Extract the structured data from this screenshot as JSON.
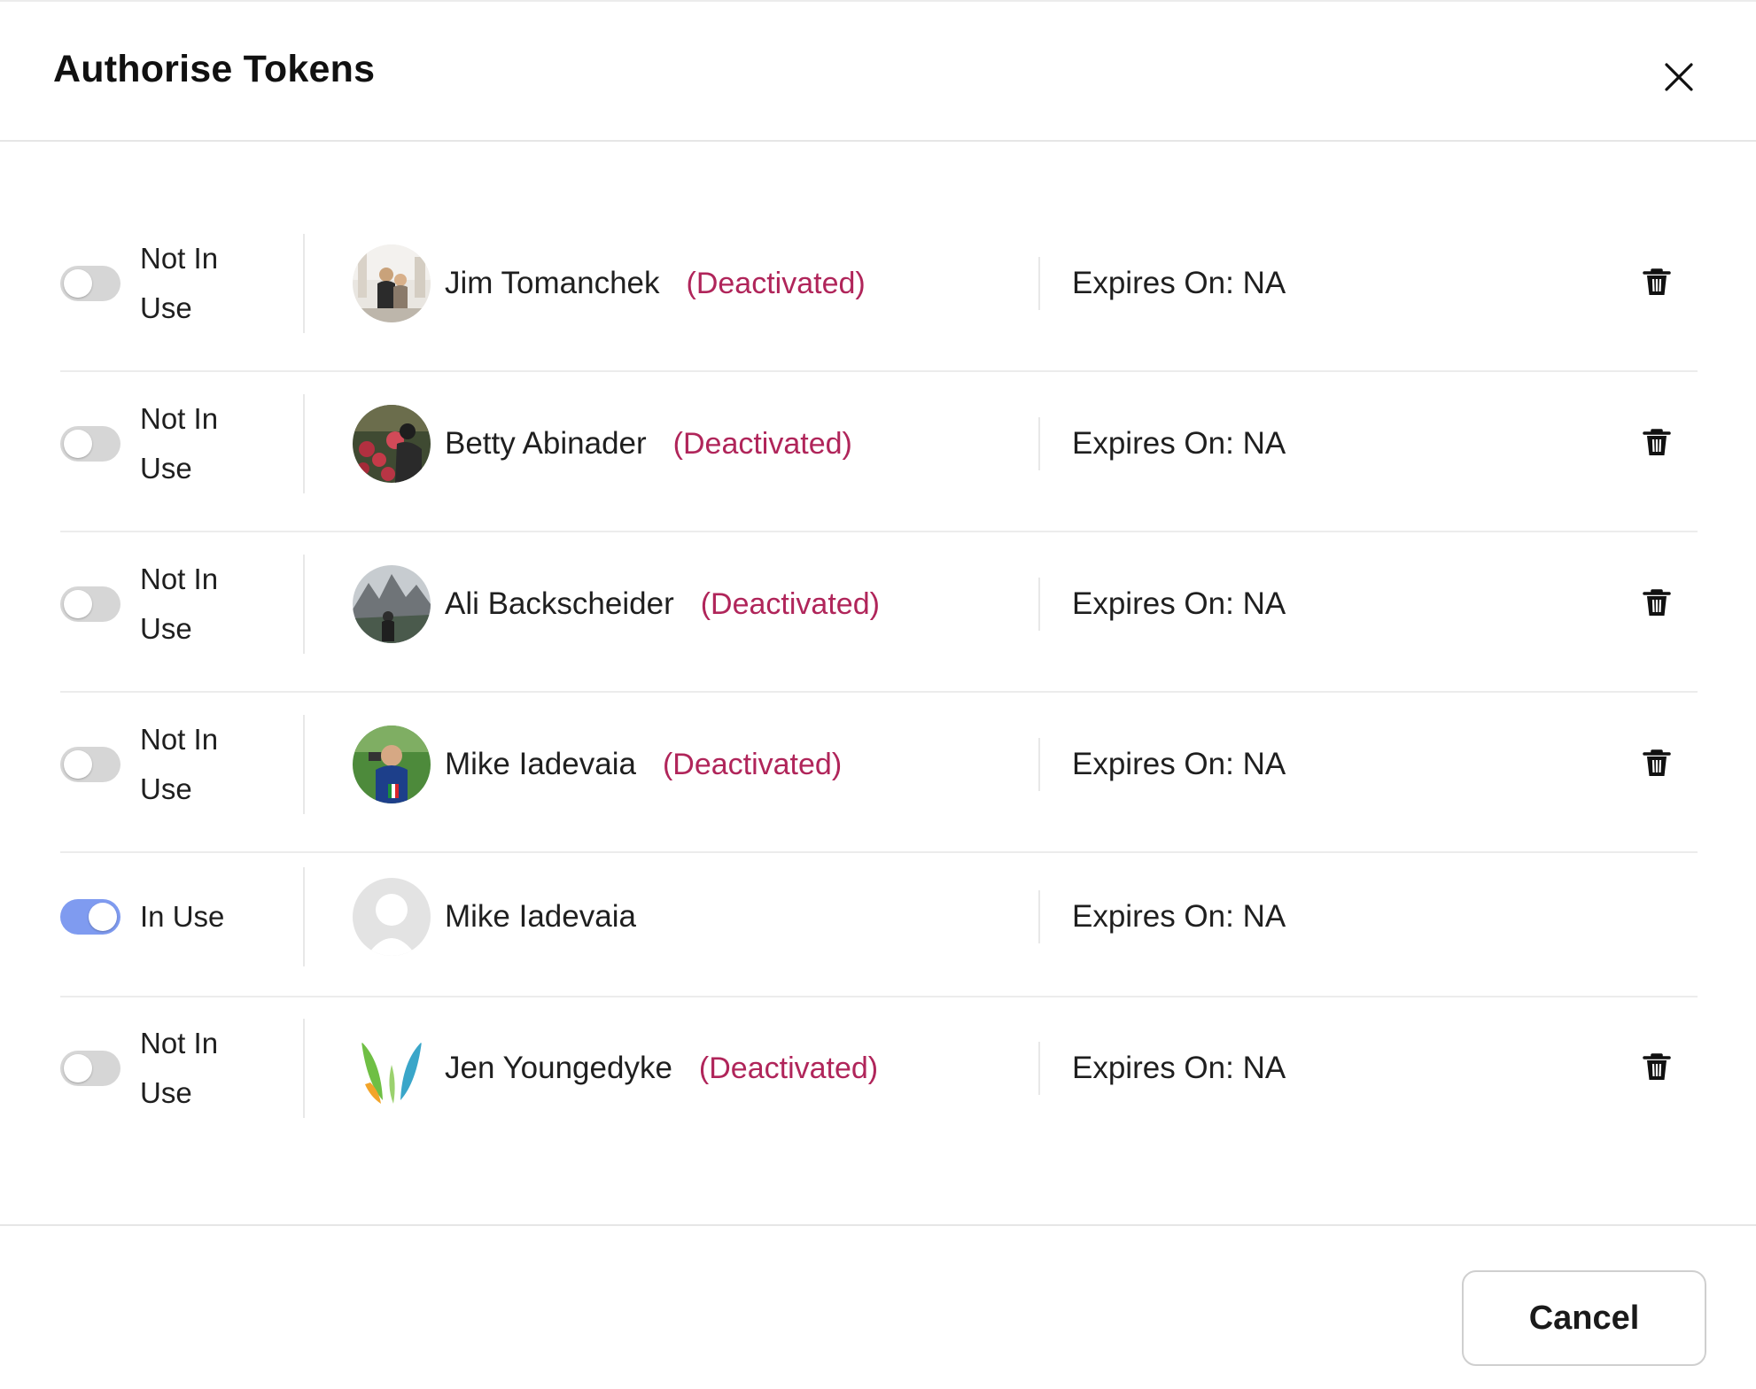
{
  "dialog": {
    "title": "Authorise Tokens",
    "close_icon": "close-icon"
  },
  "tokens": [
    {
      "status": "Not In Use",
      "status_lines": [
        "Not In",
        "Use"
      ],
      "in_use": false,
      "name": "Jim Tomanchek",
      "deactivated_label": "(Deactivated)",
      "expires": "Expires On: NA",
      "avatar": "photo-couple",
      "deletable": true
    },
    {
      "status": "Not In Use",
      "status_lines": [
        "Not In",
        "Use"
      ],
      "in_use": false,
      "name": "Betty Abinader",
      "deactivated_label": "(Deactivated)",
      "expires": "Expires On: NA",
      "avatar": "photo-roses",
      "deletable": true
    },
    {
      "status": "Not In Use",
      "status_lines": [
        "Not In",
        "Use"
      ],
      "in_use": false,
      "name": "Ali Backscheider",
      "deactivated_label": "(Deactivated)",
      "expires": "Expires On: NA",
      "avatar": "photo-mountain",
      "deletable": true
    },
    {
      "status": "Not In Use",
      "status_lines": [
        "Not In",
        "Use"
      ],
      "in_use": false,
      "name": "Mike Iadevaia",
      "deactivated_label": "(Deactivated)",
      "expires": "Expires On: NA",
      "avatar": "photo-person",
      "deletable": true
    },
    {
      "status": "In Use",
      "status_lines": [
        "In Use"
      ],
      "in_use": true,
      "name": "Mike Iadevaia",
      "deactivated_label": "",
      "expires": "Expires On: NA",
      "avatar": "default-avatar-placeholder",
      "deletable": false
    },
    {
      "status": "Not In Use",
      "status_lines": [
        "Not In",
        "Use"
      ],
      "in_use": false,
      "name": "Jen Youngedyke",
      "deactivated_label": "(Deactivated)",
      "expires": "Expires On: NA",
      "avatar": "logo-leaves",
      "deletable": true
    }
  ],
  "footer": {
    "cancel_label": "Cancel"
  },
  "colors": {
    "deactivated": "#b0255a",
    "toggle_on": "#7f9bf0",
    "toggle_off": "#d6d6d6"
  }
}
